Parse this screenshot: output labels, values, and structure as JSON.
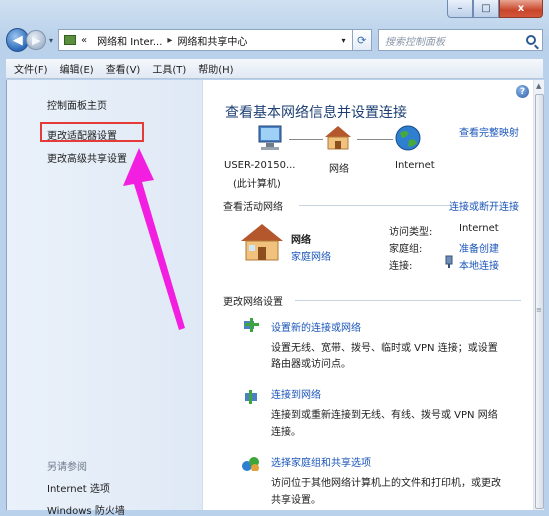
{
  "window": {
    "minimize": "–",
    "maximize": "□",
    "close": "x"
  },
  "nav": {
    "back": "◀",
    "forward": "▶",
    "dropdown": "▾",
    "address_overflow": "«",
    "address_crumb_1": "网络和 Inter...",
    "address_sep": "▸",
    "address_crumb_2": "网络和共享中心",
    "address_dropdown": "▾",
    "refresh": "⟳",
    "search_placeholder": "搜索控制面板"
  },
  "menubar": {
    "items": [
      "文件(F)",
      "编辑(E)",
      "查看(V)",
      "工具(T)",
      "帮助(H)"
    ]
  },
  "sidebar": {
    "home": "控制面板主页",
    "change_adapter": "更改适配器设置",
    "change_sharing": "更改高级共享设置",
    "see_also": "另请参阅",
    "internet_options": "Internet 选项",
    "firewall": "Windows 防火墙"
  },
  "main": {
    "help": "?",
    "title": "查看基本网络信息并设置连接",
    "view_full_map": "查看完整映射",
    "map": {
      "computer_name": "USER-20150...",
      "computer_sub": "(此计算机)",
      "network": "网络",
      "internet": "Internet"
    },
    "active_header": "查看活动网络",
    "connect_disconnect": "连接或断开连接",
    "active": {
      "name": "网络",
      "type": "家庭网络",
      "access_label": "访问类型:",
      "access_value": "Internet",
      "homegroup_label": "家庭组:",
      "homegroup_value": "准备创建",
      "conn_label": "连接:",
      "conn_value": "本地连接"
    },
    "change_header": "更改网络设置",
    "tasks": [
      {
        "title": "设置新的连接或网络",
        "desc1": "设置无线、宽带、拨号、临时或 VPN 连接；或设置",
        "desc2": "路由器或访问点。"
      },
      {
        "title": "连接到网络",
        "desc1": "连接到或重新连接到无线、有线、拨号或 VPN 网络",
        "desc2": "连接。"
      },
      {
        "title": "选择家庭组和共享选项",
        "desc1": "访问位于其他网络计算机上的文件和打印机，或更改",
        "desc2": "共享设置。"
      }
    ]
  },
  "colors": {
    "link": "#1a55b8",
    "title": "#1d3f73",
    "highlight_box": "#e53b38",
    "arrow": "#f21fe0"
  }
}
